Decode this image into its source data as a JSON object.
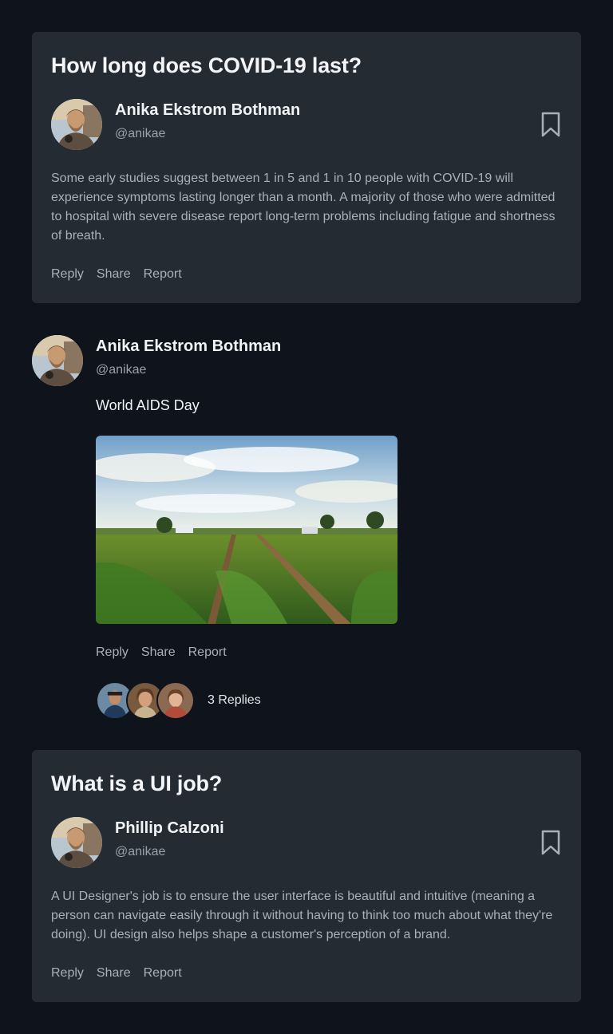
{
  "questions": [
    {
      "title": "How long does COVID-19 last?",
      "author_name": "Anika Ekstrom Bothman",
      "author_handle": "@anikae",
      "body": "Some early studies suggest between 1 in 5 and 1 in 10 people with COVID-19 will experience symptoms lasting longer than a month. A majority of those who were admitted to hospital with severe disease report long-term problems including fatigue and shortness of breath.",
      "actions": [
        "Reply",
        "Share",
        "Report"
      ]
    },
    {
      "title": "What is a UI job?",
      "author_name": "Phillip Calzoni",
      "author_handle": "@anikae",
      "body": "A UI Designer's job is to ensure the user interface is beautiful and intuitive (meaning a person can navigate easily through it without having to think too much about what they're doing). UI design also helps shape a customer's perception of a brand.",
      "actions": [
        "Reply",
        "Share",
        "Report"
      ]
    }
  ],
  "post": {
    "author_name": "Anika Ekstrom Bothman",
    "author_handle": "@anikae",
    "text": "World AIDS Day",
    "actions": [
      "Reply",
      "Share",
      "Report"
    ],
    "replies_label": "3 Replies"
  },
  "icons": {
    "bookmark": "bookmark-icon"
  },
  "colors": {
    "background": "#0f141c",
    "card": "#252b33",
    "muted_text": "#a9b0ba"
  }
}
